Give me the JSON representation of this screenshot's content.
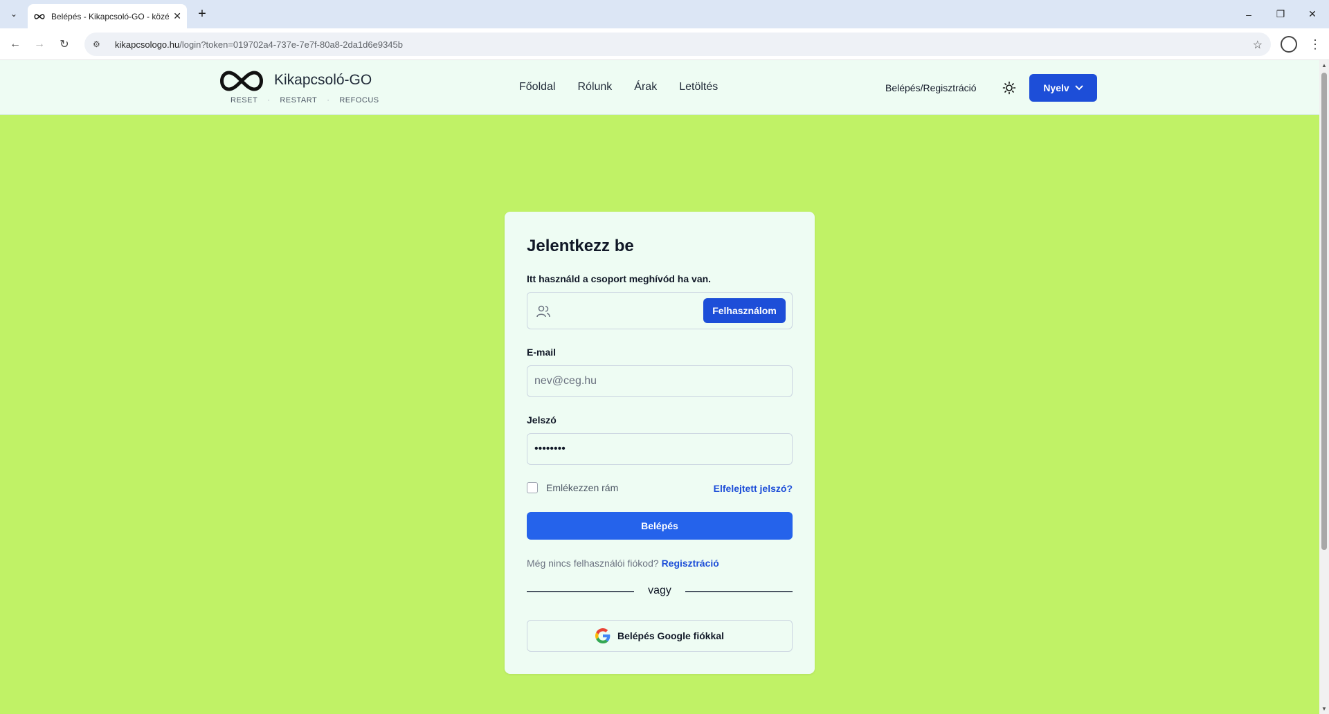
{
  "browser": {
    "tab_title": "Belépés - Kikapcsoló-GO - közé",
    "url_host": "kikapcsologo.hu",
    "url_path": "/login?token=019702a4-737e-7e7f-80a8-2da1d6e9345b"
  },
  "header": {
    "brand": "Kikapcsoló-GO",
    "tagline": [
      "RESET",
      "RESTART",
      "REFOCUS"
    ],
    "nav": [
      "Főoldal",
      "Rólunk",
      "Árak",
      "Letöltés"
    ],
    "login_register": "Belépés/Regisztráció",
    "language_button": "Nyelv"
  },
  "login": {
    "title": "Jelentkezz be",
    "invite_label": "Itt használd a csoport meghívód ha van.",
    "invite_button": "Felhasználom",
    "email_label": "E-mail",
    "email_placeholder": "nev@ceg.hu",
    "password_label": "Jelszó",
    "password_value": "••••••••",
    "remember_me": "Emlékezzen rám",
    "forgot_password": "Elfelejtett jelszó?",
    "submit": "Belépés",
    "no_account": "Még nincs felhasználói fiókod?",
    "register_link": "Regisztráció",
    "or": "vagy",
    "google_button": "Belépés Google fiókkal"
  },
  "colors": {
    "background": "#c0f266",
    "card": "#eefcf3",
    "primary": "#2563eb",
    "primary_dark": "#1d4ed8"
  }
}
